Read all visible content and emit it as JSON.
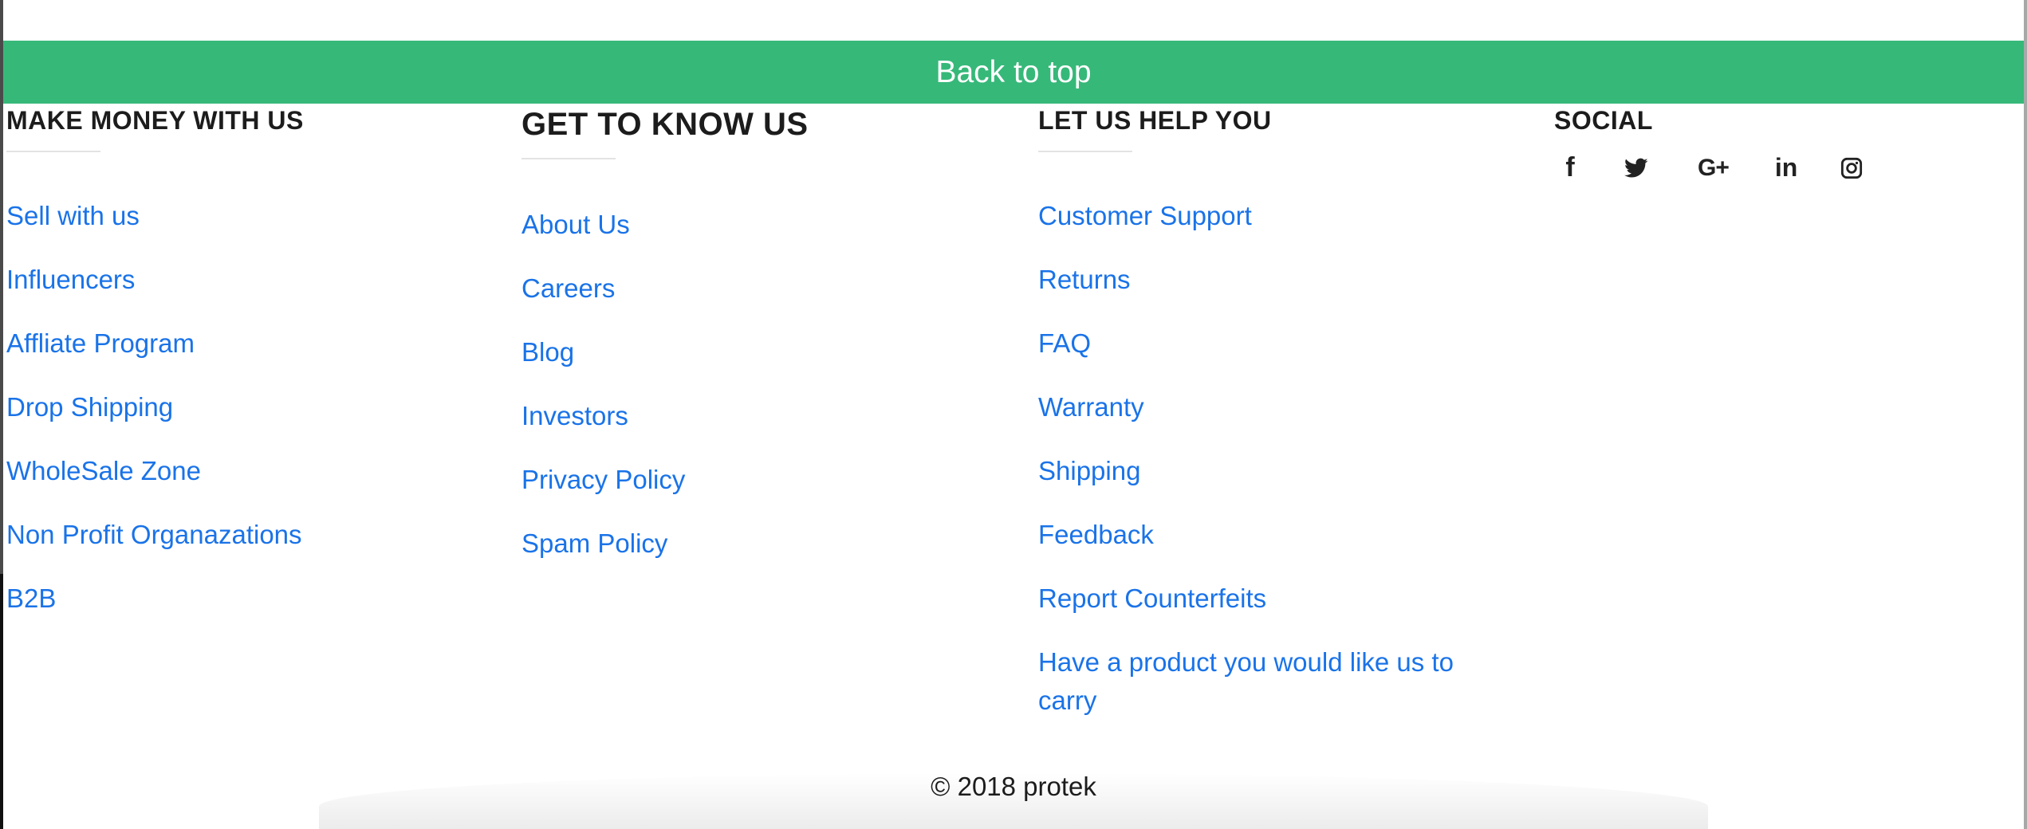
{
  "back_to_top": "Back to top",
  "columns": {
    "make_money": {
      "heading": "MAKE MONEY WITH US",
      "links": [
        "Sell with us",
        "Influencers",
        "Affliate Program",
        "Drop Shipping",
        "WholeSale Zone",
        "Non Profit Organazations",
        "B2B"
      ]
    },
    "get_to_know": {
      "heading": "GET TO KNOW US",
      "links": [
        "About Us",
        "Careers",
        "Blog",
        "Investors",
        "Privacy Policy",
        "Spam Policy"
      ]
    },
    "help": {
      "heading": "LET US HELP YOU",
      "links": [
        "Customer Support",
        "Returns",
        "FAQ",
        "Warranty",
        "Shipping",
        "Feedback",
        "Report Counterfeits",
        "Have a product you would like us to carry"
      ]
    },
    "social": {
      "heading": "SOCIAL",
      "icons": [
        "facebook-icon",
        "twitter-icon",
        "google-plus-icon",
        "linkedin-icon",
        "instagram-icon"
      ]
    }
  },
  "copyright": "© 2018 protek",
  "colors": {
    "accent_green": "#36b879",
    "link_blue": "#1a73e8",
    "heading_text": "#1c1c1c"
  }
}
